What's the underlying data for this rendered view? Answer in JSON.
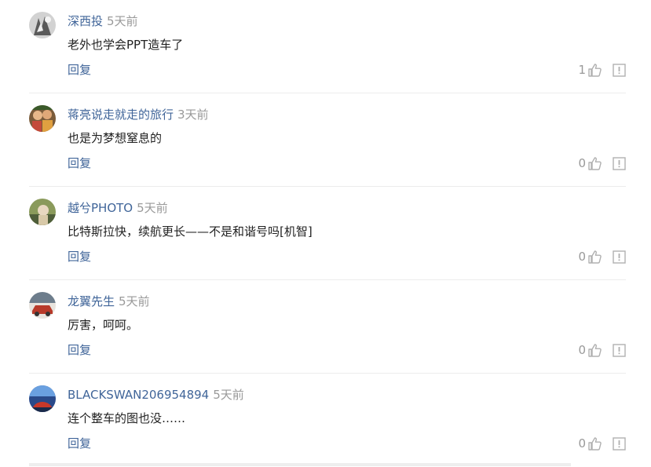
{
  "comments": [
    {
      "username": "深西投",
      "time": "5天前",
      "content": "老外也学会PPT造车了",
      "reply_label": "回复",
      "likes": "1",
      "avatar_colors": [
        "#c9c9c9",
        "#555555",
        "#f2f2f2"
      ]
    },
    {
      "username": "蒋亮说走就走的旅行",
      "time": "3天前",
      "content": "也是为梦想窒息的",
      "reply_label": "回复",
      "likes": "0",
      "avatar_colors": [
        "#7a5b3a",
        "#e0a040",
        "#c44a3a"
      ]
    },
    {
      "username": "越兮PHOTO",
      "time": "5天前",
      "content": "比特斯拉快，续航更长——不是和谐号吗[机智]",
      "reply_label": "回复",
      "likes": "0",
      "avatar_colors": [
        "#8a9a5b",
        "#d8c9a8",
        "#4f5e3a"
      ]
    },
    {
      "username": "龙翼先生",
      "time": "5天前",
      "content": "厉害，呵呵。",
      "reply_label": "回复",
      "likes": "0",
      "avatar_colors": [
        "#6d7d8c",
        "#b83a2a",
        "#e8e4de"
      ]
    },
    {
      "username": "BLACKSWAN206954894",
      "time": "5天前",
      "content": "连个整车的图也没……",
      "reply_label": "回复",
      "likes": "0",
      "avatar_colors": [
        "#2a4a8a",
        "#c8382a",
        "#6aa0e0"
      ]
    }
  ],
  "colors": {
    "link": "#406599",
    "muted": "#999999",
    "text": "#222222",
    "icon": "#b0b0b0"
  }
}
